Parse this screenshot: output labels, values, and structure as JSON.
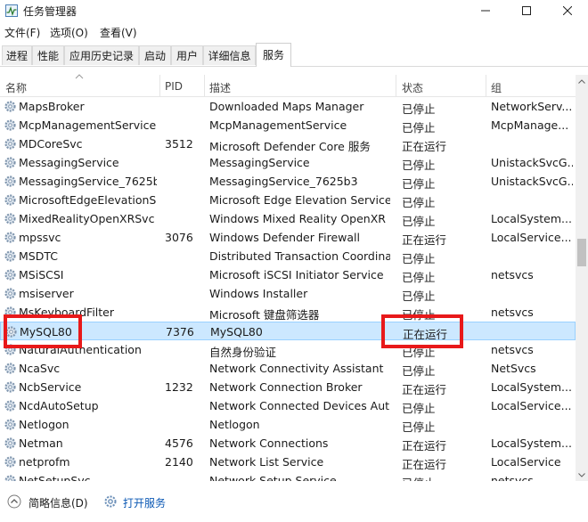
{
  "window": {
    "title": "任务管理器"
  },
  "menu": [
    "文件(F)",
    "选项(O)",
    "查看(V)"
  ],
  "tabs": [
    "进程",
    "性能",
    "应用历史记录",
    "启动",
    "用户",
    "详细信息",
    "服务"
  ],
  "columns": {
    "name": "名称",
    "pid": "PID",
    "desc": "描述",
    "status": "状态",
    "group": "组"
  },
  "rows": [
    {
      "name": "MapsBroker",
      "pid": "",
      "desc": "Downloaded Maps Manager",
      "status": "已停止",
      "group": "NetworkServ..."
    },
    {
      "name": "McpManagementService",
      "pid": "",
      "desc": "McpManagementService",
      "status": "已停止",
      "group": "McpManage..."
    },
    {
      "name": "MDCoreSvc",
      "pid": "3512",
      "desc": "Microsoft Defender Core 服务",
      "status": "正在运行",
      "group": ""
    },
    {
      "name": "MessagingService",
      "pid": "",
      "desc": "MessagingService",
      "status": "已停止",
      "group": "UnistackSvcG..."
    },
    {
      "name": "MessagingService_7625b3",
      "pid": "",
      "desc": "MessagingService_7625b3",
      "status": "已停止",
      "group": "UnistackSvcG..."
    },
    {
      "name": "MicrosoftEdgeElevationS...",
      "pid": "",
      "desc": "Microsoft Edge Elevation Service...",
      "status": "已停止",
      "group": ""
    },
    {
      "name": "MixedRealityOpenXRSvc",
      "pid": "",
      "desc": "Windows Mixed Reality OpenXR ...",
      "status": "已停止",
      "group": "LocalSystem..."
    },
    {
      "name": "mpssvc",
      "pid": "3076",
      "desc": "Windows Defender Firewall",
      "status": "正在运行",
      "group": "LocalService..."
    },
    {
      "name": "MSDTC",
      "pid": "",
      "desc": "Distributed Transaction Coordina...",
      "status": "已停止",
      "group": ""
    },
    {
      "name": "MSiSCSI",
      "pid": "",
      "desc": "Microsoft iSCSI Initiator Service",
      "status": "已停止",
      "group": "netsvcs"
    },
    {
      "name": "msiserver",
      "pid": "",
      "desc": "Windows Installer",
      "status": "已停止",
      "group": ""
    },
    {
      "name": "MsKeyboardFilter",
      "pid": "",
      "desc": "Microsoft 键盘筛选器",
      "status": "已停止",
      "group": "netsvcs"
    },
    {
      "name": "MySQL80",
      "pid": "7376",
      "desc": "MySQL80",
      "status": "正在运行",
      "group": ""
    },
    {
      "name": "NaturalAuthentication",
      "pid": "",
      "desc": "自然身份验证",
      "status": "已停止",
      "group": "netsvcs"
    },
    {
      "name": "NcaSvc",
      "pid": "",
      "desc": "Network Connectivity Assistant",
      "status": "已停止",
      "group": "NetSvcs"
    },
    {
      "name": "NcbService",
      "pid": "1232",
      "desc": "Network Connection Broker",
      "status": "正在运行",
      "group": "LocalSystem..."
    },
    {
      "name": "NcdAutoSetup",
      "pid": "",
      "desc": "Network Connected Devices Aut...",
      "status": "已停止",
      "group": "LocalService..."
    },
    {
      "name": "Netlogon",
      "pid": "",
      "desc": "Netlogon",
      "status": "已停止",
      "group": ""
    },
    {
      "name": "Netman",
      "pid": "4576",
      "desc": "Network Connections",
      "status": "正在运行",
      "group": "LocalSystem..."
    },
    {
      "name": "netprofm",
      "pid": "2140",
      "desc": "Network List Service",
      "status": "正在运行",
      "group": "LocalService"
    },
    {
      "name": "NetSetupSvc",
      "pid": "",
      "desc": "Network Setup Service",
      "status": "已停止",
      "group": "netsvcs"
    }
  ],
  "selected_row": 12,
  "footer": {
    "brief": "简略信息(D)",
    "open_services": "打开服务"
  },
  "colors": {
    "selection": "#cce8ff",
    "highlight_box": "#e8191a",
    "link": "#0b58b4"
  }
}
